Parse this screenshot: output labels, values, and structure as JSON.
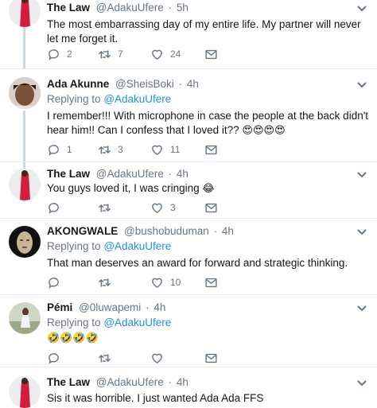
{
  "tweets": [
    {
      "name": "The Law",
      "handle": "@AdakuUfere",
      "time": "5h",
      "replying_prefix": "",
      "replying_to": "",
      "text": "The most embarrassing day of my entire life. My partner will never let me forget it.",
      "replies": "2",
      "retweets": "7",
      "likes": "24"
    },
    {
      "name": "Ada Akunne",
      "handle": "@SheisBoki",
      "time": "4h",
      "replying_prefix": "Replying to",
      "replying_to": "@AdakuUfere",
      "text": "I remember!!! With microphone in case the people at the back didn't hear him!! Can I confess that I loved it??",
      "emoji": "😍😍😍😍",
      "replies": "1",
      "retweets": "3",
      "likes": "11"
    },
    {
      "name": "The Law",
      "handle": "@AdakuUfere",
      "time": "4h",
      "replying_prefix": "",
      "replying_to": "",
      "text": "You guys loved it, I was cringing",
      "emoji": "😂",
      "replies": "",
      "retweets": "",
      "likes": "3"
    },
    {
      "name": "AKONGWALE",
      "handle": "@bushobuduman",
      "time": "4h",
      "replying_prefix": "Replying to",
      "replying_to": "@AdakuUfere",
      "text": "That man deserves an award for forward and strategic thinking.",
      "replies": "",
      "retweets": "",
      "likes": "10"
    },
    {
      "name": "Pémi",
      "handle": "@0luwapemi",
      "time": "4h",
      "replying_prefix": "Replying to",
      "replying_to": "@AdakuUfere",
      "text": "",
      "emoji": "🤣🤣🤣🤣",
      "replies": "",
      "retweets": "",
      "likes": ""
    },
    {
      "name": "The Law",
      "handle": "@AdakuUfere",
      "time": "4h",
      "replying_prefix": "",
      "replying_to": "",
      "text": "Sis it was horrible. I just wanted Ada Ada FFS",
      "replies": "",
      "retweets": "",
      "likes": ""
    }
  ],
  "colors": {
    "muted": "#657786",
    "link": "#1b95e0",
    "divider": "#e6ecf0",
    "thread": "#ccd6dd"
  },
  "icons": [
    "reply-icon",
    "retweet-icon",
    "like-icon",
    "message-icon",
    "chevron-down-icon"
  ]
}
